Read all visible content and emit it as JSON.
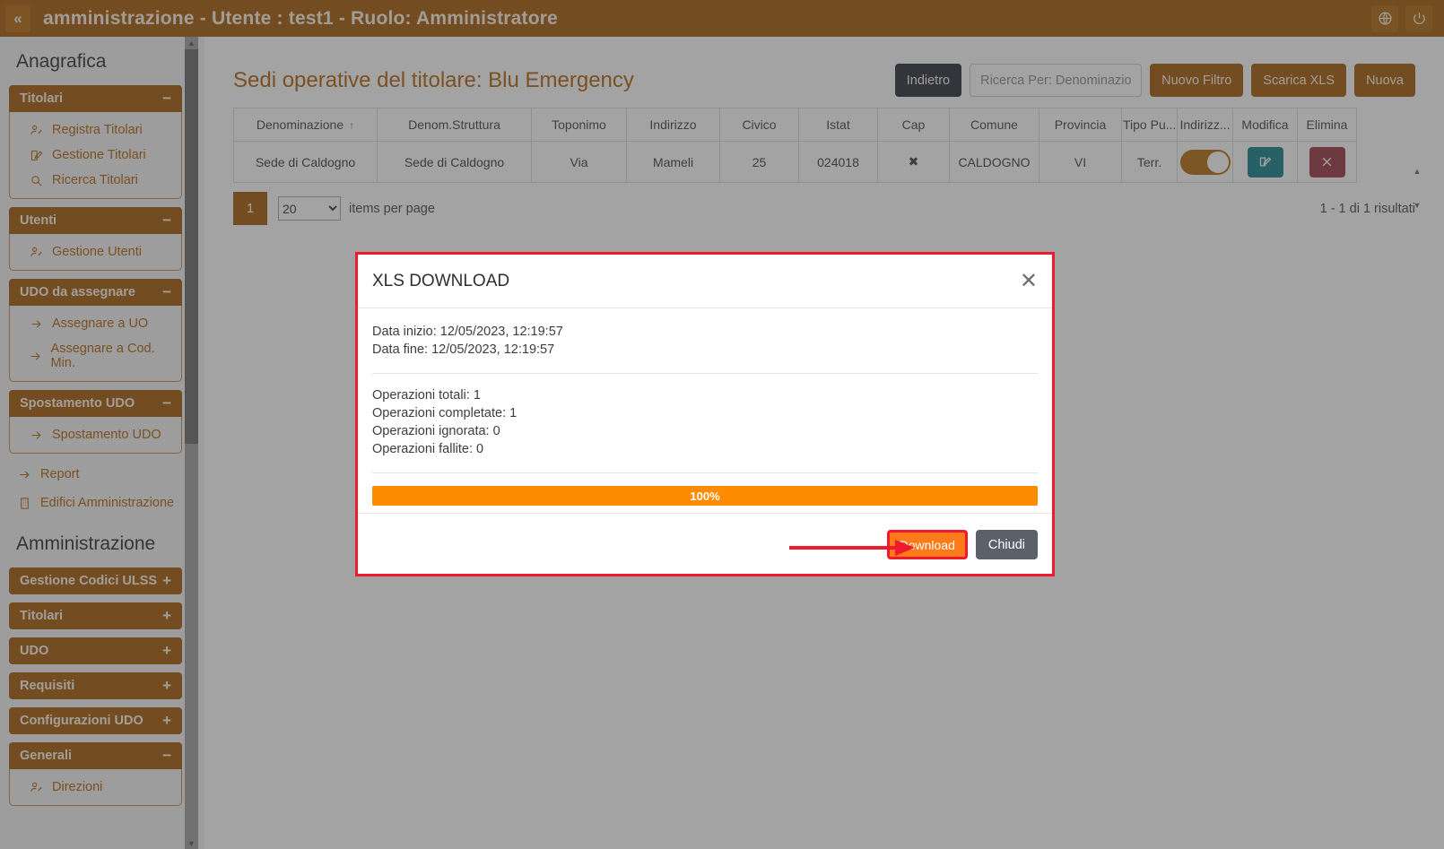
{
  "topbar": {
    "collapse_label": "«",
    "title": "amministrazione - Utente : test1 - Ruolo: Amministratore",
    "language_icon": "globe-icon",
    "logout_icon": "power-icon"
  },
  "sidebar": {
    "section_anagrafica": "Anagrafica",
    "section_amministrazione": "Amministrazione",
    "groups": [
      {
        "label": "Titolari",
        "sign": "−",
        "expanded": true,
        "items": [
          {
            "label": "Registra Titolari",
            "icon": "user-add-icon"
          },
          {
            "label": "Gestione Titolari",
            "icon": "edit-icon"
          },
          {
            "label": "Ricerca Titolari",
            "icon": "search-icon"
          }
        ]
      },
      {
        "label": "Utenti",
        "sign": "−",
        "expanded": true,
        "items": [
          {
            "label": "Gestione Utenti",
            "icon": "user-add-icon"
          }
        ]
      },
      {
        "label": "UDO da assegnare",
        "sign": "−",
        "expanded": true,
        "items": [
          {
            "label": "Assegnare a UO",
            "icon": "arrow-right-icon"
          },
          {
            "label": "Assegnare a Cod. Min.",
            "icon": "arrow-right-icon"
          }
        ]
      },
      {
        "label": "Spostamento UDO",
        "sign": "−",
        "expanded": true,
        "items": [
          {
            "label": "Spostamento UDO",
            "icon": "arrow-right-icon"
          }
        ]
      }
    ],
    "plain_links": [
      {
        "label": "Report",
        "icon": "arrow-right-icon"
      },
      {
        "label": "Edifici Amministrazione",
        "icon": "building-icon"
      }
    ],
    "admin_groups": [
      {
        "label": "Gestione Codici ULSS",
        "sign": "+",
        "expanded": false,
        "items": []
      },
      {
        "label": "Titolari",
        "sign": "+",
        "expanded": false,
        "items": []
      },
      {
        "label": "UDO",
        "sign": "+",
        "expanded": false,
        "items": []
      },
      {
        "label": "Requisiti",
        "sign": "+",
        "expanded": false,
        "items": []
      },
      {
        "label": "Configurazioni UDO",
        "sign": "+",
        "expanded": false,
        "items": []
      },
      {
        "label": "Generali",
        "sign": "−",
        "expanded": true,
        "items": [
          {
            "label": "Direzioni",
            "icon": "user-add-icon"
          }
        ]
      }
    ]
  },
  "main": {
    "page_title": "Sedi operative del titolare: Blu Emergency",
    "toolbar": {
      "back_label": "Indietro",
      "search_placeholder": "Ricerca Per: Denominazione",
      "search_value": "",
      "new_filter_label": "Nuovo Filtro",
      "download_xls_label": "Scarica XLS",
      "new_label": "Nuova"
    },
    "table": {
      "columns": [
        "Denominazione",
        "Denom.Struttura",
        "Toponimo",
        "Indirizzo",
        "Civico",
        "Istat",
        "Cap",
        "Comune",
        "Provincia",
        "Tipo Pu...",
        "Indirizz...",
        "Modifica",
        "Elimina"
      ],
      "sort_column": "Denominazione",
      "sort_direction": "↑",
      "rows": [
        {
          "denominazione": "Sede di Caldogno",
          "denom_struttura": "Sede di Caldogno",
          "toponimo": "Via",
          "indirizzo": "Mameli",
          "civico": "25",
          "istat": "024018",
          "cap": "✖",
          "comune": "CALDOGNO",
          "provincia": "VI",
          "tipo_pu": "Terr.",
          "indirizz_toggle": "on",
          "modifica_icon": "edit-icon",
          "elimina_icon": "close-icon"
        }
      ]
    },
    "pager": {
      "current_page": "1",
      "items_per_page_value": "20",
      "items_per_page_options": [
        "20"
      ],
      "items_per_page_label": "items per page",
      "results_text": "1 - 1 di 1 risultati"
    }
  },
  "modal": {
    "title": "XLS DOWNLOAD",
    "close_icon": "close-icon",
    "lines_top": [
      "Data inizio: 12/05/2023, 12:19:57",
      "Data fine: 12/05/2023, 12:19:57"
    ],
    "lines_stats": [
      "Operazioni totali: 1",
      "Operazioni completate: 1",
      "Operazioni ignorata: 0",
      "Operazioni fallite: 0"
    ],
    "progress_label": "100%",
    "progress_value": 100,
    "download_label": "Download",
    "close_label": "Chiudi"
  },
  "colors": {
    "brand": "#a45d0a",
    "accent_orange": "#ff7a18",
    "annotation_red": "#ef1a2d",
    "teal": "#18808f",
    "danger": "#9e3744"
  }
}
